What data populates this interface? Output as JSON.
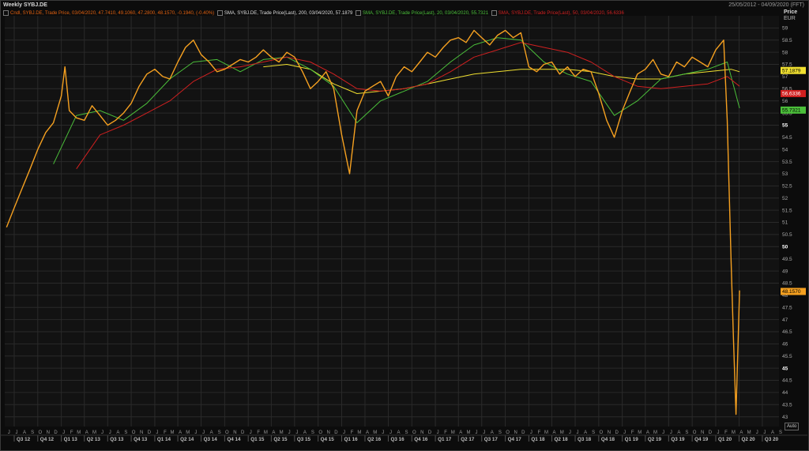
{
  "header": {
    "title": "Weekly SYBJ.DE",
    "date_range": "25/05/2012 - 04/09/2020 (FFT)",
    "price_label": "Price",
    "currency": "EUR",
    "auto_label": "Auto"
  },
  "legend": [
    {
      "text": "Cndl, SYBJ.DE, Trade Price, 03/04/2020, 47.7410, 49.1060, 47.2800, 48.1570, -0.1940, (-0.40%)",
      "color": "#e06010"
    },
    {
      "text": "SMA, SYBJ.DE, Trade Price(Last), 200, 03/04/2020, 57.1879",
      "color": "#dcdcdc"
    },
    {
      "text": "SMA, SYBJ.DE, Trade Price(Last), 20, 03/04/2020, 55.7321",
      "color": "#4bbf3a"
    },
    {
      "text": "SMA, SYBJ.DE, Trade Price(Last), 50, 03/04/2020, 56.6336",
      "color": "#d02020"
    }
  ],
  "chart_data": {
    "type": "line",
    "title": "Weekly SYBJ.DE",
    "ylabel": "Price",
    "yunit": "EUR",
    "ylim": [
      42.6,
      59.5
    ],
    "xlim": [
      "2012-05-25",
      "2020-09-04"
    ],
    "y_ticks": [
      "43",
      "43.5",
      "44",
      "44.5",
      "45",
      "45.5",
      "46",
      "46.5",
      "47",
      "47.5",
      "48",
      "48.5",
      "49",
      "49.5",
      "50",
      "50.5",
      "51",
      "51.5",
      "52",
      "52.5",
      "53",
      "53.5",
      "54",
      "54.5",
      "55",
      "55.5",
      "56",
      "56.5",
      "57",
      "57.5",
      "58",
      "58.5",
      "59"
    ],
    "y_ticks_major": [
      "45",
      "50",
      "55"
    ],
    "month_labels": [
      "J",
      "J",
      "A",
      "S",
      "O",
      "N",
      "D",
      "J",
      "F",
      "M",
      "A",
      "M",
      "J",
      "J",
      "A",
      "S",
      "O",
      "N",
      "D",
      "J",
      "F",
      "M",
      "A",
      "M",
      "J",
      "J",
      "A",
      "S",
      "O",
      "N",
      "D",
      "J",
      "F",
      "M",
      "A",
      "M",
      "J",
      "J",
      "A",
      "S",
      "O",
      "N",
      "D",
      "J",
      "F",
      "M",
      "A",
      "M",
      "J",
      "J",
      "A",
      "S",
      "O",
      "N",
      "D",
      "J",
      "F",
      "M",
      "A",
      "M",
      "J",
      "J",
      "A",
      "S",
      "O",
      "N",
      "D",
      "J",
      "F",
      "M",
      "A",
      "M",
      "J",
      "J",
      "A",
      "S",
      "O",
      "N",
      "D",
      "J",
      "F",
      "M",
      "A",
      "M",
      "J",
      "J",
      "A",
      "S",
      "O",
      "N",
      "D",
      "J",
      "F",
      "M",
      "A",
      "M",
      "J",
      "J",
      "A",
      "S",
      "O",
      "N",
      "D",
      "J",
      "F",
      "M",
      "A",
      "M",
      "J",
      "J",
      "A",
      "S"
    ],
    "quarter_labels": [
      "Q3 12",
      "Q4 12",
      "Q1 13",
      "Q2 13",
      "Q3 13",
      "Q4 13",
      "Q1 14",
      "Q2 14",
      "Q3 14",
      "Q4 14",
      "Q1 15",
      "Q2 15",
      "Q3 15",
      "Q4 15",
      "Q1 16",
      "Q2 16",
      "Q3 16",
      "Q4 16",
      "Q1 17",
      "Q2 17",
      "Q3 17",
      "Q4 17",
      "Q1 18",
      "Q2 18",
      "Q3 18",
      "Q4 18",
      "Q1 19",
      "Q2 19",
      "Q3 19",
      "Q4 19",
      "Q1 20",
      "Q2 20",
      "Q3 20"
    ],
    "price_series": {
      "name": "SYBJ.DE Trade Price",
      "color": "#f5a020",
      "x": [
        "2012-06-01",
        "2012-07-01",
        "2012-08-01",
        "2012-09-01",
        "2012-10-01",
        "2012-11-01",
        "2012-12-01",
        "2013-01-01",
        "2013-01-15",
        "2013-02-01",
        "2013-03-01",
        "2013-04-01",
        "2013-05-01",
        "2013-06-01",
        "2013-07-01",
        "2013-08-01",
        "2013-09-01",
        "2013-10-01",
        "2013-11-01",
        "2013-12-01",
        "2014-01-01",
        "2014-02-01",
        "2014-03-01",
        "2014-04-01",
        "2014-05-01",
        "2014-06-01",
        "2014-07-01",
        "2014-08-01",
        "2014-09-01",
        "2014-10-01",
        "2014-11-01",
        "2014-12-01",
        "2015-01-01",
        "2015-02-01",
        "2015-03-01",
        "2015-04-01",
        "2015-05-01",
        "2015-06-01",
        "2015-07-01",
        "2015-08-01",
        "2015-09-01",
        "2015-10-01",
        "2015-11-01",
        "2015-12-01",
        "2016-01-01",
        "2016-02-01",
        "2016-03-01",
        "2016-04-01",
        "2016-05-01",
        "2016-06-01",
        "2016-07-01",
        "2016-08-01",
        "2016-09-01",
        "2016-10-01",
        "2016-11-01",
        "2016-12-01",
        "2017-01-01",
        "2017-02-01",
        "2017-03-01",
        "2017-04-01",
        "2017-05-01",
        "2017-06-01",
        "2017-07-01",
        "2017-08-01",
        "2017-09-01",
        "2017-10-01",
        "2017-11-01",
        "2017-12-01",
        "2018-01-01",
        "2018-02-01",
        "2018-03-01",
        "2018-04-01",
        "2018-05-01",
        "2018-06-01",
        "2018-07-01",
        "2018-08-01",
        "2018-09-01",
        "2018-10-01",
        "2018-11-01",
        "2018-12-01",
        "2019-01-01",
        "2019-02-01",
        "2019-03-01",
        "2019-04-01",
        "2019-05-01",
        "2019-06-01",
        "2019-07-01",
        "2019-08-01",
        "2019-09-01",
        "2019-10-01",
        "2019-11-01",
        "2019-12-01",
        "2020-01-01",
        "2020-02-01",
        "2020-02-15",
        "2020-03-01",
        "2020-03-10",
        "2020-03-20",
        "2020-04-03"
      ],
      "values": [
        50.8,
        51.6,
        52.4,
        53.2,
        54.0,
        54.7,
        55.1,
        56.2,
        57.4,
        55.6,
        55.3,
        55.2,
        55.8,
        55.4,
        55.0,
        55.2,
        55.5,
        55.9,
        56.6,
        57.1,
        57.3,
        57.0,
        56.9,
        57.6,
        58.2,
        58.5,
        57.9,
        57.6,
        57.2,
        57.3,
        57.5,
        57.7,
        57.6,
        57.8,
        58.1,
        57.8,
        57.6,
        58.0,
        57.8,
        57.2,
        56.5,
        56.8,
        57.2,
        56.5,
        54.6,
        53.0,
        55.6,
        56.4,
        56.6,
        56.8,
        56.2,
        57.0,
        57.4,
        57.2,
        57.6,
        58.0,
        57.8,
        58.2,
        58.5,
        58.6,
        58.4,
        58.9,
        58.6,
        58.3,
        58.7,
        58.9,
        58.6,
        58.8,
        57.4,
        57.2,
        57.5,
        57.6,
        57.1,
        57.4,
        57.0,
        57.3,
        57.2,
        56.3,
        55.2,
        54.5,
        55.6,
        56.4,
        57.1,
        57.3,
        57.7,
        57.1,
        57.0,
        57.6,
        57.4,
        57.8,
        57.6,
        57.4,
        58.1,
        58.5,
        55.2,
        49.4,
        46.3,
        43.1,
        48.2
      ]
    },
    "sma_series": [
      {
        "name": "SMA 200",
        "color": "#f0e030",
        "label": "57.1879",
        "x": [
          "2015-03-01",
          "2015-06-01",
          "2015-09-01",
          "2015-12-01",
          "2016-03-01",
          "2016-06-01",
          "2016-09-01",
          "2016-12-01",
          "2017-03-01",
          "2017-06-01",
          "2017-09-01",
          "2017-12-01",
          "2018-03-01",
          "2018-06-01",
          "2018-09-01",
          "2018-12-01",
          "2019-03-01",
          "2019-06-01",
          "2019-09-01",
          "2019-12-01",
          "2020-03-01",
          "2020-04-03"
        ],
        "values": [
          57.4,
          57.5,
          57.3,
          56.7,
          56.3,
          56.4,
          56.5,
          56.7,
          56.9,
          57.1,
          57.2,
          57.3,
          57.3,
          57.3,
          57.2,
          57.0,
          56.9,
          56.9,
          57.1,
          57.2,
          57.3,
          57.2
        ]
      },
      {
        "name": "SMA 20",
        "color": "#4bbf3a",
        "label": "55.7321",
        "x": [
          "2012-12-01",
          "2013-03-01",
          "2013-06-01",
          "2013-09-01",
          "2013-12-01",
          "2014-03-01",
          "2014-06-01",
          "2014-09-01",
          "2014-12-01",
          "2015-03-01",
          "2015-06-01",
          "2015-09-01",
          "2015-12-01",
          "2016-03-01",
          "2016-06-01",
          "2016-09-01",
          "2016-12-01",
          "2017-03-01",
          "2017-06-01",
          "2017-09-01",
          "2017-12-01",
          "2018-03-01",
          "2018-06-01",
          "2018-09-01",
          "2018-12-01",
          "2019-03-01",
          "2019-06-01",
          "2019-09-01",
          "2019-12-01",
          "2020-02-15",
          "2020-04-03"
        ],
        "values": [
          53.4,
          55.4,
          55.6,
          55.2,
          55.9,
          56.9,
          57.6,
          57.7,
          57.2,
          57.7,
          57.8,
          57.3,
          56.6,
          55.1,
          56.0,
          56.4,
          56.8,
          57.6,
          58.3,
          58.6,
          58.5,
          57.6,
          57.1,
          56.8,
          55.4,
          56.0,
          56.9,
          57.1,
          57.3,
          57.6,
          55.7
        ]
      },
      {
        "name": "SMA 50",
        "color": "#d02020",
        "label": "56.6336",
        "x": [
          "2013-03-01",
          "2013-06-01",
          "2013-09-01",
          "2013-12-01",
          "2014-03-01",
          "2014-06-01",
          "2014-09-01",
          "2014-12-01",
          "2015-03-01",
          "2015-06-01",
          "2015-09-01",
          "2015-12-01",
          "2016-03-01",
          "2016-06-01",
          "2016-09-01",
          "2016-12-01",
          "2017-03-01",
          "2017-06-01",
          "2017-09-01",
          "2017-12-01",
          "2018-03-01",
          "2018-06-01",
          "2018-09-01",
          "2018-12-01",
          "2019-03-01",
          "2019-06-01",
          "2019-09-01",
          "2019-12-01",
          "2020-02-15",
          "2020-04-03"
        ],
        "values": [
          53.2,
          54.6,
          55.0,
          55.5,
          56.0,
          56.8,
          57.3,
          57.4,
          57.6,
          57.8,
          57.6,
          57.1,
          56.5,
          56.4,
          56.5,
          56.7,
          57.2,
          57.8,
          58.1,
          58.4,
          58.2,
          58.0,
          57.6,
          57.0,
          56.6,
          56.5,
          56.6,
          56.7,
          57.0,
          56.6
        ]
      }
    ],
    "last_price_label": {
      "value": 48.157,
      "text": "48.1570",
      "color": "#f5a020"
    },
    "grid": true
  }
}
